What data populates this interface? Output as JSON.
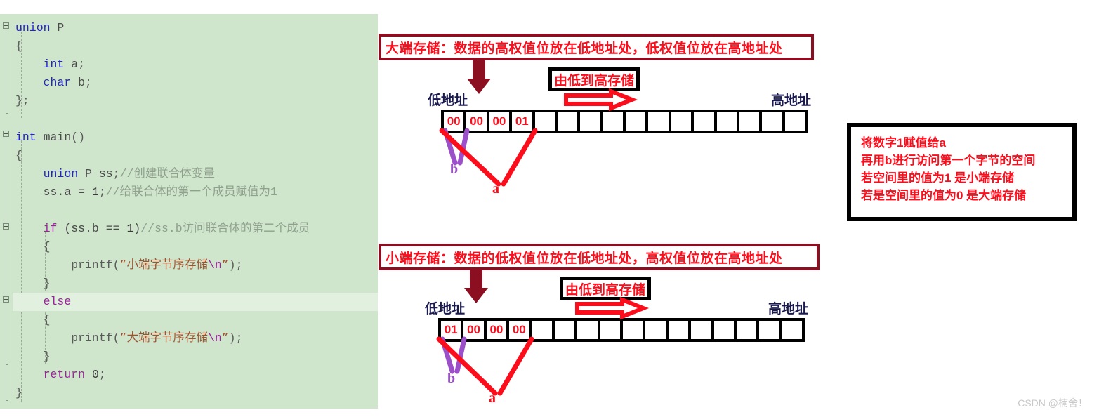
{
  "code_panel": {
    "language": "c",
    "lines": [
      {
        "id": "l1",
        "text": "union P",
        "fold": true
      },
      {
        "id": "l2",
        "text": "{"
      },
      {
        "id": "l3",
        "text": "    int a;"
      },
      {
        "id": "l4",
        "text": "    char b;"
      },
      {
        "id": "l5",
        "text": "};"
      },
      {
        "id": "l6",
        "text": ""
      },
      {
        "id": "l7",
        "text": "int main()",
        "fold": true
      },
      {
        "id": "l8",
        "text": "{"
      },
      {
        "id": "l9",
        "text": "    union P ss;//创建联合体变量"
      },
      {
        "id": "l10",
        "text": "    ss.a = 1;//给联合体的第一个成员赋值为1"
      },
      {
        "id": "l11",
        "text": ""
      },
      {
        "id": "l12",
        "text": "    if (ss.b == 1)//ss.b访问联合体的第二个成员",
        "fold": true
      },
      {
        "id": "l13",
        "text": "    {"
      },
      {
        "id": "l14",
        "text": "        printf(\"小端字节序存储\\n\");"
      },
      {
        "id": "l15",
        "text": "    }"
      },
      {
        "id": "l16",
        "text": "    else",
        "highlighted": true,
        "fold": true
      },
      {
        "id": "l17",
        "text": "    {"
      },
      {
        "id": "l18",
        "text": "        printf(\"大端字节序存储\\n\");"
      },
      {
        "id": "l19",
        "text": "    }"
      },
      {
        "id": "l20",
        "text": "    return 0;"
      },
      {
        "id": "l21",
        "text": "}"
      }
    ],
    "tokens": {
      "union_kw": "union",
      "int_kw": "int",
      "char_kw": "char",
      "if_kw": "if",
      "else_kw": "else",
      "return_kw": "return",
      "printf_fn": "printf",
      "struct_name": "P",
      "var_a": "a",
      "var_b": "b",
      "var_ss": "ss",
      "comment_1": "//创建联合体变量",
      "comment_2": "//给联合体的第一个成员赋值为1",
      "comment_3": "//ss.b访问联合体的第二个成员",
      "string_little": "\"小端字节序存储\\n\"",
      "string_big": "\"大端字节序存储\\n\"",
      "string_little_body": "小端字节序存储",
      "string_big_body": "大端字节序存储",
      "escape_n": "\\n",
      "main_fn": "main"
    }
  },
  "big_endian": {
    "banner_text": "大端存储：数据的高权值位放在低地址处，低权值位放在高地址处",
    "low_address_label": "低地址",
    "high_address_label": "高地址",
    "flow_label": "由低到高存储",
    "memory_cells": [
      "00",
      "00",
      "00",
      "01",
      "",
      "",
      "",
      "",
      "",
      "",
      "",
      "",
      "",
      "",
      "",
      ""
    ],
    "label_b": "b",
    "label_a": "a"
  },
  "little_endian": {
    "banner_text": "小端存储：数据的低权值位放在低地址处，高权值位放在高地址处",
    "low_address_label": "低地址",
    "high_address_label": "高地址",
    "flow_label": "由低到高存储",
    "memory_cells": [
      "01",
      "00",
      "00",
      "00",
      "",
      "",
      "",
      "",
      "",
      "",
      "",
      "",
      "",
      "",
      "",
      ""
    ],
    "label_b": "b",
    "label_a": "a"
  },
  "note": {
    "line1": "将数字1赋值给a",
    "line2": "再用b进行访问第一个字节的空间",
    "line3": "若空间里的值为1  是小端存储",
    "line4": "若是空间里的值为0  是大端存储"
  },
  "watermark": {
    "text": "CSDN @楠舍！"
  },
  "colors": {
    "code_bg": "#cfe6cd",
    "code_highlight": "#e2f0e0",
    "banner_border": "#8b0f20",
    "accent_red": "#fc0d1b",
    "address_label": "#1a1a4e",
    "purple": "#9b4fc8",
    "black": "#000000"
  }
}
